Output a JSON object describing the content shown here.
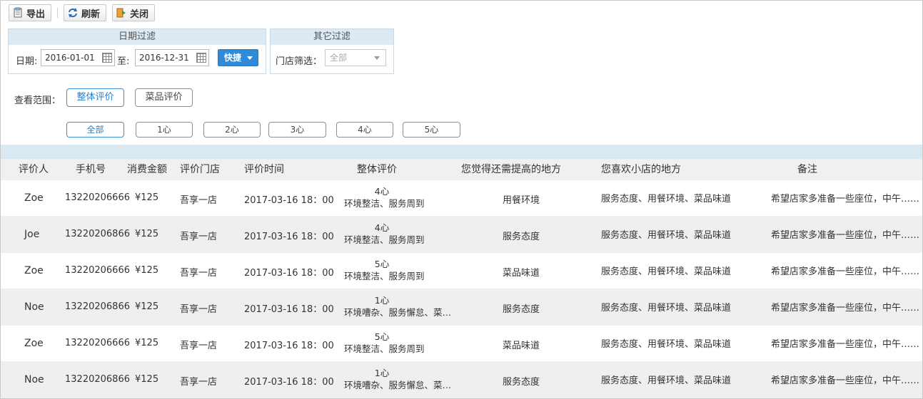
{
  "toolbar": {
    "export_label": "导出",
    "refresh_label": "刷新",
    "close_label": "关闭"
  },
  "date_filter": {
    "title": "日期过滤",
    "date_label": "日期:",
    "start_date": "2016-01-01",
    "to_label": "至:",
    "end_date": "2016-12-31",
    "quick_label": "快捷"
  },
  "other_filter": {
    "title": "其它过滤",
    "store_label": "门店筛选：",
    "store_value": "全部"
  },
  "scope": {
    "label": "查看范围：",
    "overall": "整体评价",
    "dish": "菜品评价"
  },
  "rating_filters": [
    "全部",
    "1心",
    "2心",
    "3心",
    "4心",
    "5心"
  ],
  "table": {
    "headers": [
      "评价人",
      "手机号",
      "消费金额",
      "评价门店",
      "评价时间",
      "整体评价",
      "您觉得还需提高的地方",
      "您喜欢小店的地方",
      "备注"
    ],
    "rows": [
      {
        "name": "Zoe",
        "phone": "13220206666",
        "amount": "¥125",
        "store": "吾享一店",
        "time": "2017-03-16 18：00",
        "hearts": "4心",
        "comment": "环境整洁、服务周到",
        "improve": "用餐环境",
        "like": "服务态度、用餐环境、菜品味道",
        "note": "希望店家多准备一些座位，中午……"
      },
      {
        "name": "Joe",
        "phone": "13220206866",
        "amount": "¥125",
        "store": "吾享一店",
        "time": "2017-03-16 18：00",
        "hearts": "4心",
        "comment": "环境整洁、服务周到",
        "improve": "服务态度",
        "like": "服务态度、用餐环境、菜品味道",
        "note": "希望店家多准备一些座位，中午……"
      },
      {
        "name": "Zoe",
        "phone": "13220206666",
        "amount": "¥125",
        "store": "吾享一店",
        "time": "2017-03-16 18：00",
        "hearts": "5心",
        "comment": "环境整洁、服务周到",
        "improve": "菜品味道",
        "like": "服务态度、用餐环境、菜品味道",
        "note": "希望店家多准备一些座位，中午……"
      },
      {
        "name": "Noe",
        "phone": "13220206866",
        "amount": "¥125",
        "store": "吾享一店",
        "time": "2017-03-16 18：00",
        "hearts": "1心",
        "comment": "环境嘈杂、服务懈怠、菜…",
        "improve": "服务态度",
        "like": "服务态度、用餐环境、菜品味道",
        "note": "希望店家多准备一些座位，中午……"
      },
      {
        "name": "Zoe",
        "phone": "13220206666",
        "amount": "¥125",
        "store": "吾享一店",
        "time": "2017-03-16 18：00",
        "hearts": "5心",
        "comment": "环境整洁、服务周到",
        "improve": "菜品味道",
        "like": "服务态度、用餐环境、菜品味道",
        "note": "希望店家多准备一些座位，中午……"
      },
      {
        "name": "Noe",
        "phone": "13220206866",
        "amount": "¥125",
        "store": "吾享一店",
        "time": "2017-03-16 18：00",
        "hearts": "1心",
        "comment": "环境嘈杂、服务懈怠、菜…",
        "improve": "服务态度",
        "like": "服务态度、用餐环境、菜品味道",
        "note": "希望店家多准备一些座位，中午……"
      }
    ]
  },
  "colors": {
    "accent": "#2f8bd7",
    "panel_header": "#dde9f3",
    "band": "#dae8f2",
    "row_alt": "#efefef"
  },
  "icons": [
    "export-icon",
    "refresh-icon",
    "close-icon",
    "calendar-icon",
    "chevron-down-icon"
  ]
}
